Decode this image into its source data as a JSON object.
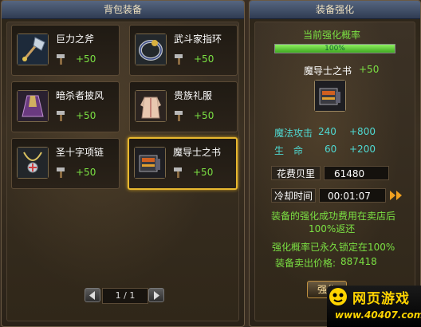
{
  "bag": {
    "title": "背包装备",
    "items": [
      {
        "name": "巨力之斧",
        "bonus": "+50",
        "icon": "axe-icon"
      },
      {
        "name": "武斗家指环",
        "bonus": "+50",
        "icon": "ring-icon"
      },
      {
        "name": "暗杀者披风",
        "bonus": "+50",
        "icon": "cloak-icon"
      },
      {
        "name": "贵族礼服",
        "bonus": "+50",
        "icon": "robe-icon"
      },
      {
        "name": "圣十字项链",
        "bonus": "+50",
        "icon": "necklace-icon"
      },
      {
        "name": "魔导士之书",
        "bonus": "+50",
        "icon": "spellbook-icon",
        "selected": true
      }
    ],
    "pager": {
      "text": "1 / 1"
    }
  },
  "enhance": {
    "title": "装备强化",
    "rate_label": "当前强化概率",
    "rate_text": "100%",
    "rate_value": 1.0,
    "item_name": "魔导士之书",
    "item_bonus": "+50",
    "stats": [
      {
        "label": "魔法攻击",
        "value": "240",
        "bonus": "+800"
      },
      {
        "label": "生　命",
        "value": "60",
        "bonus": "+200"
      }
    ],
    "cost_label": "花费贝里",
    "cost_value": "61480",
    "cooldown_label": "冷却时间",
    "cooldown_value": "00:01:07",
    "note_line1": "装备的强化成功费用在卖店后",
    "note_line2": "100%返还",
    "lock_note": "强化概率已永久锁定在100%",
    "sell_label": "装备卖出价格:",
    "sell_value": "887418",
    "button_label": "强化"
  },
  "watermark": {
    "title": "网页游戏",
    "url": "www.40407.com"
  },
  "colors": {
    "bonus_green": "#7be043",
    "stat_cyan": "#4fd9d2",
    "selected_border": "#e8b830"
  }
}
